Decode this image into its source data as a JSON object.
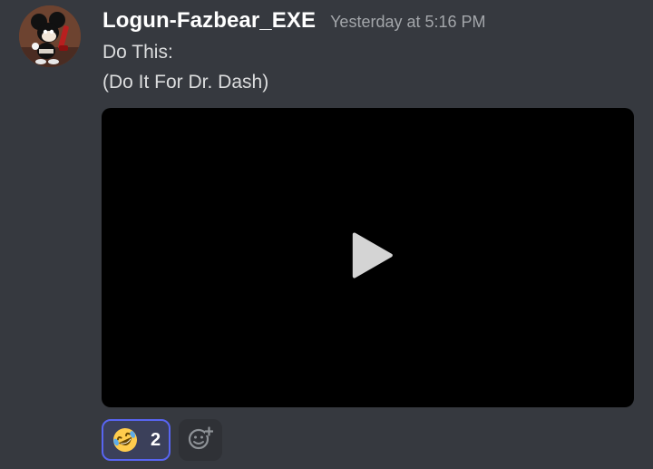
{
  "message": {
    "username": "Logun-Fazbear_EXE",
    "timestamp": "Yesterday at 5:16 PM",
    "lines": [
      "Do This:",
      "(Do It For Dr. Dash)"
    ]
  },
  "reactions": [
    {
      "emoji": "rolling-on-floor-laughing",
      "count": "2",
      "selected": true
    }
  ],
  "icons": {
    "play": "play-icon",
    "add_reaction": "add-reaction-icon"
  },
  "colors": {
    "background": "#36393f",
    "username": "#ffffff",
    "timestamp": "#a3a6aa",
    "text": "#dcddde",
    "video": "#000000",
    "reaction_border": "#5865f2",
    "reaction_bg": "#3b405a",
    "add_reaction_bg": "#2f3136"
  }
}
